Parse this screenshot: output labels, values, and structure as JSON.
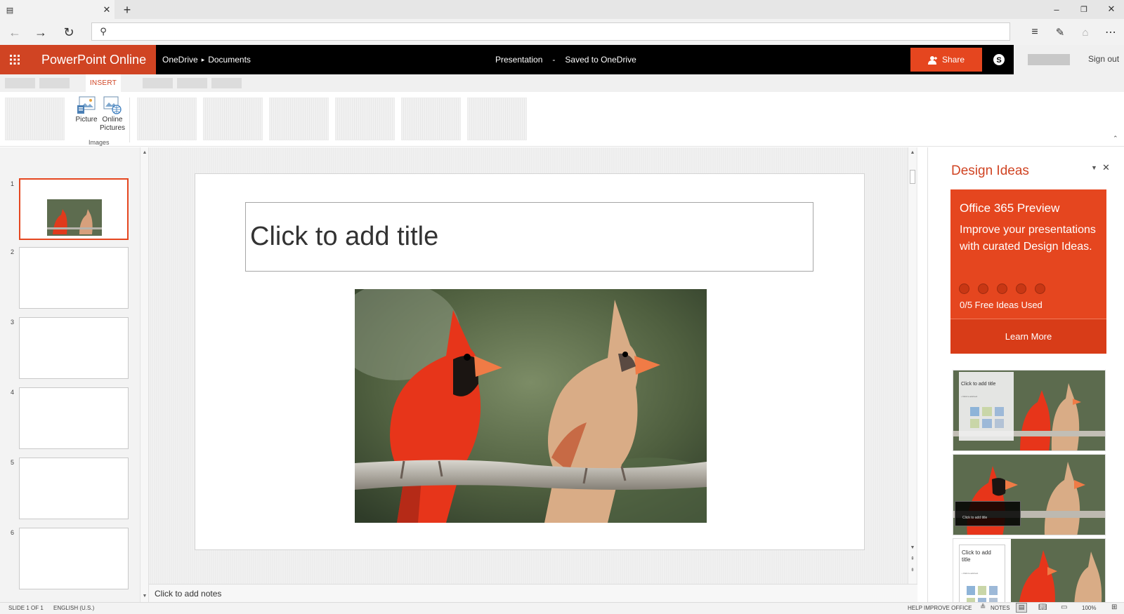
{
  "browser": {
    "colors": {
      "tabbar": "#e6e6e6",
      "addrbar": "#f2f2f2"
    },
    "icons": [
      "tab-icon",
      "close-tab-icon",
      "new-tab-icon",
      "minimize-icon",
      "restore-icon",
      "close-window-icon",
      "back-icon",
      "forward-icon",
      "refresh-icon",
      "search-icon",
      "hub-icon",
      "note-icon",
      "share-icon",
      "more-icon"
    ],
    "address": ""
  },
  "app": {
    "brand": "PowerPoint Online",
    "breadcrumb": {
      "root": "OneDrive",
      "separator": "▸",
      "folder": "Documents"
    },
    "doc": {
      "name": "Presentation",
      "separator": "-",
      "status": "Saved to OneDrive"
    },
    "share_label": "Share",
    "signout_label": "Sign out",
    "colors": {
      "accent": "#d04423",
      "share": "#e5461f",
      "appbar": "#000000"
    }
  },
  "ribbon": {
    "active_tab": "INSERT",
    "buttons": {
      "picture": "Picture",
      "online_pictures": "Online Pictures"
    },
    "group_label": "Images"
  },
  "thumbnails": {
    "items": [
      {
        "num": "1"
      },
      {
        "num": "2"
      },
      {
        "num": "3"
      },
      {
        "num": "4"
      },
      {
        "num": "5"
      },
      {
        "num": "6"
      }
    ]
  },
  "slide": {
    "title_placeholder": "Click to add title"
  },
  "notes": {
    "placeholder": "Click to add notes"
  },
  "design": {
    "title": "Design Ideas",
    "promo_title": "Office 365 Preview",
    "promo_desc": "Improve your presentations with curated Design Ideas.",
    "promo_used": "0/5 Free Ideas Used",
    "learn_more": "Learn More",
    "idea1_title": "Click to add title",
    "idea2_title": "Click to add title",
    "idea3_title": "Click to add title",
    "idea_text": "• Click to add text"
  },
  "status": {
    "slide_info": "SLIDE 1 OF 1",
    "language": "ENGLISH (U.S.)",
    "help": "HELP IMPROVE OFFICE",
    "notes": "NOTES",
    "zoom": "100%"
  }
}
